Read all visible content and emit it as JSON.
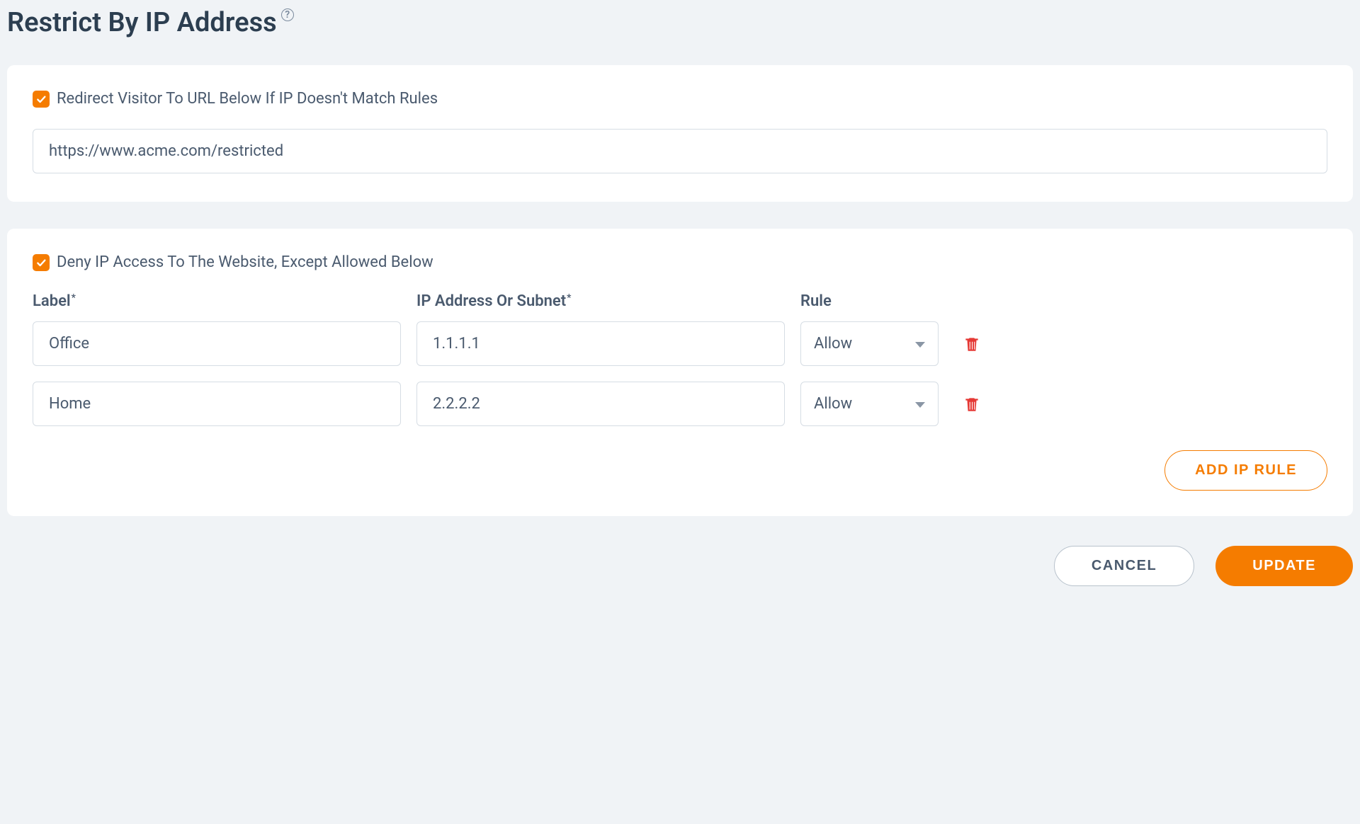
{
  "page": {
    "title": "Restrict By IP Address"
  },
  "redirect": {
    "checked": true,
    "label": "Redirect Visitor To URL Below If IP Doesn't Match Rules",
    "url": "https://www.acme.com/restricted"
  },
  "deny": {
    "checked": true,
    "label": "Deny IP Access To The Website, Except Allowed Below"
  },
  "columns": {
    "label": "Label",
    "ip": "IP Address Or Subnet",
    "rule": "Rule"
  },
  "rules": [
    {
      "label": "Office",
      "ip": "1.1.1.1",
      "rule": "Allow"
    },
    {
      "label": "Home",
      "ip": "2.2.2.2",
      "rule": "Allow"
    }
  ],
  "buttons": {
    "add_rule": "ADD IP RULE",
    "cancel": "CANCEL",
    "update": "UPDATE"
  }
}
